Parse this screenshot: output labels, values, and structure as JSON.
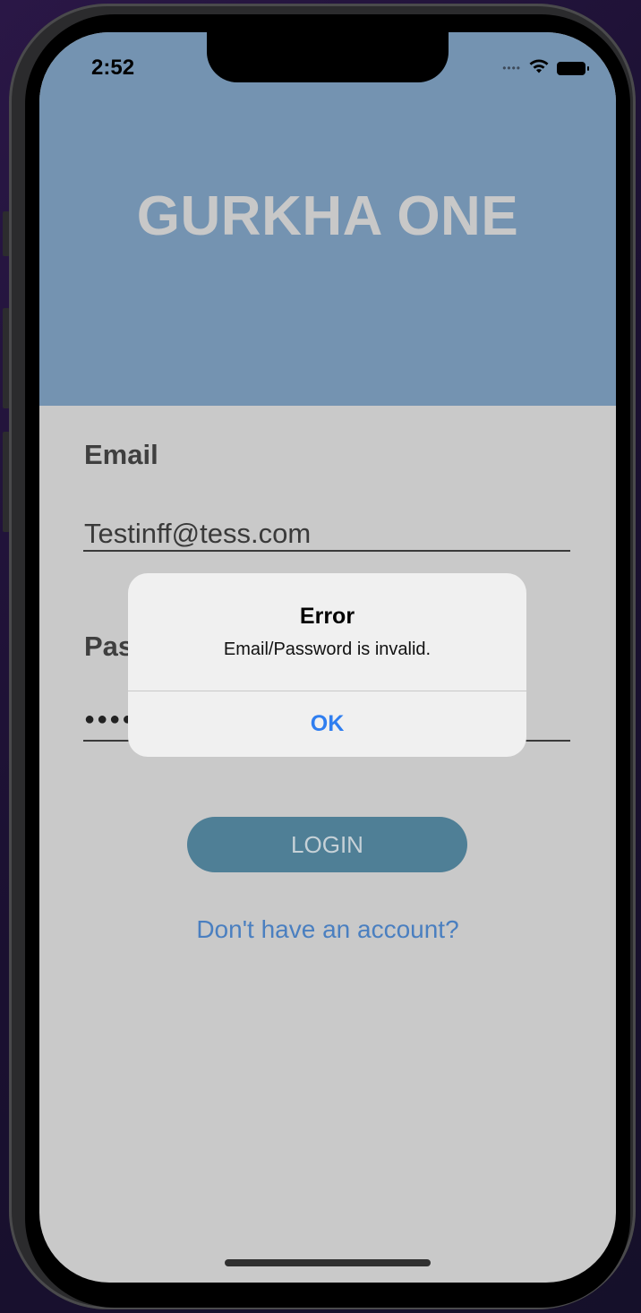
{
  "status_bar": {
    "time": "2:52",
    "signal_icon": "cellular-dots-icon",
    "wifi_icon": "wifi-icon",
    "battery_icon": "battery-icon"
  },
  "header": {
    "title": "GURKHA ONE",
    "background_color": "#7493b1"
  },
  "form": {
    "email_label": "Email",
    "email_value": "Testinff@tess.com",
    "password_label": "Password",
    "password_value_masked": "●●●●●●●●",
    "login_label": "LOGIN",
    "signup_link": "Don't have an account?"
  },
  "alert": {
    "title": "Error",
    "message": "Email/Password is invalid.",
    "ok_label": "OK"
  },
  "colors": {
    "accent_link": "#4a7fc0",
    "button": "#4f7f96",
    "alert_action": "#2f7ef0",
    "screen_background": "#c9c9c9"
  }
}
